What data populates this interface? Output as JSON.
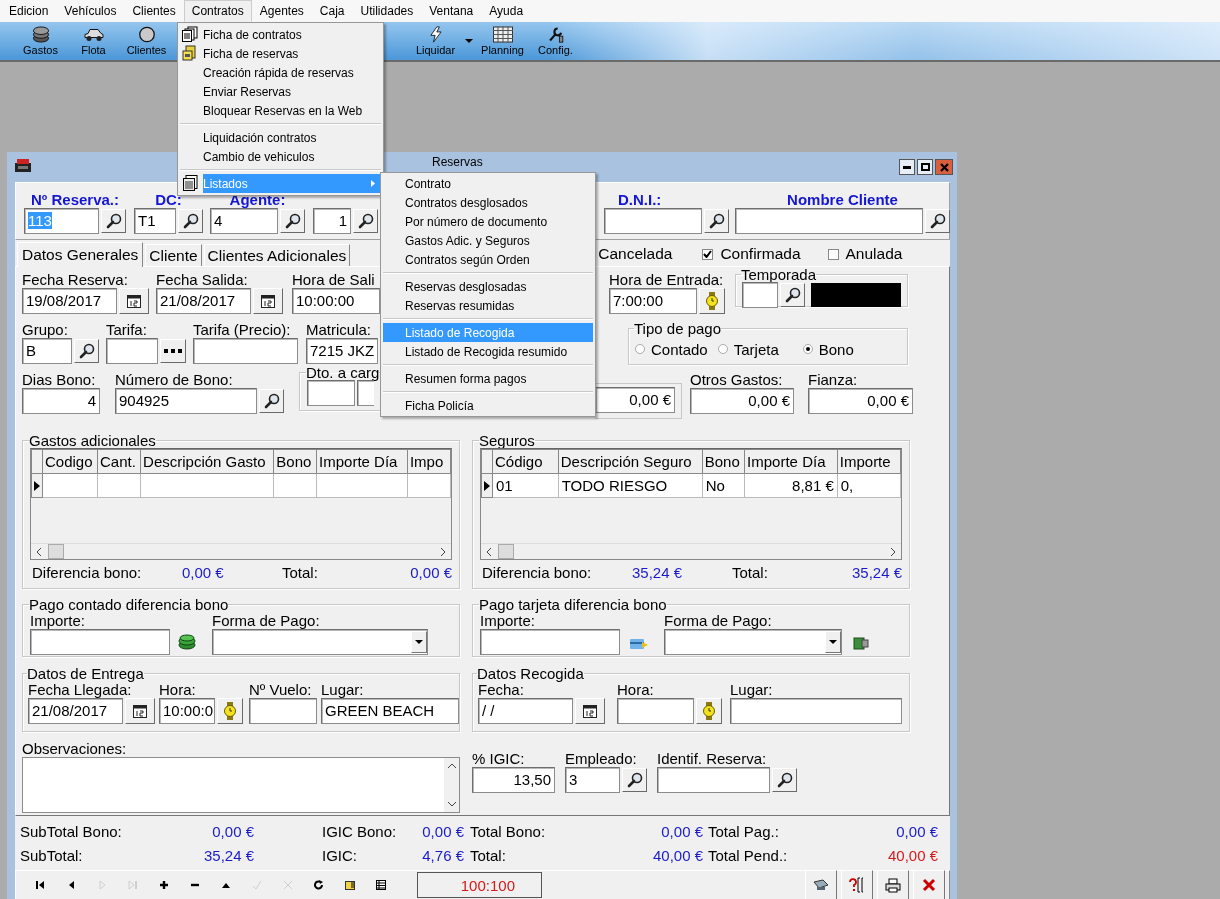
{
  "menu_bar": {
    "items": [
      {
        "label": "Edicion",
        "selected": false
      },
      {
        "label": "Vehículos",
        "selected": false
      },
      {
        "label": "Clientes",
        "selected": false
      },
      {
        "label": "Contratos",
        "selected": true
      },
      {
        "label": "Agentes",
        "selected": false
      },
      {
        "label": "Caja",
        "selected": false
      },
      {
        "label": "Utilidades",
        "selected": false
      },
      {
        "label": "Ventana",
        "selected": false
      },
      {
        "label": "Ayuda",
        "selected": false
      }
    ]
  },
  "toolbar": {
    "buttons": [
      {
        "kind": "money",
        "label": "Gastos"
      },
      {
        "kind": "car",
        "label": "Flota"
      },
      {
        "kind": "circle",
        "label": "Clientes"
      },
      {
        "kind": "bolt",
        "label": "Liquidar"
      },
      {
        "kind": "dropdown"
      },
      {
        "kind": "grid",
        "label": "Planning"
      },
      {
        "kind": "tool",
        "label": "Config."
      }
    ]
  },
  "contratos_menu": {
    "items": [
      {
        "kind": "item",
        "label": "Ficha de contratos",
        "selected": false
      },
      {
        "kind": "item",
        "label": "Ficha de reservas",
        "selected": false
      },
      {
        "kind": "item",
        "label": "Creación rápida de reservas",
        "selected": false
      },
      {
        "kind": "item",
        "label": "Enviar Reservas",
        "selected": false
      },
      {
        "kind": "item",
        "label": "Bloquear Reservas en la Web",
        "selected": false
      },
      {
        "kind": "separator"
      },
      {
        "kind": "item",
        "label": "Liquidación contratos",
        "selected": false
      },
      {
        "kind": "item",
        "label": "Cambio de vehiculos",
        "selected": false
      },
      {
        "kind": "separator"
      },
      {
        "kind": "submenu",
        "label": "Listados",
        "selected": true
      }
    ]
  },
  "listados_menu": {
    "items": [
      {
        "kind": "item",
        "label": "Contrato",
        "selected": false
      },
      {
        "kind": "item",
        "label": "Contratos desglosados",
        "selected": false
      },
      {
        "kind": "item",
        "label": "Por número de documento",
        "selected": false
      },
      {
        "kind": "item",
        "label": "Gastos Adic. y Seguros",
        "selected": false
      },
      {
        "kind": "item",
        "label": "Contratos según Orden",
        "selected": false
      },
      {
        "kind": "separator"
      },
      {
        "kind": "item",
        "label": "Reservas desglosadas",
        "selected": false
      },
      {
        "kind": "item",
        "label": "Reservas resumidas",
        "selected": false
      },
      {
        "kind": "separator"
      },
      {
        "kind": "item",
        "label": "Listado de Recogida",
        "selected": true
      },
      {
        "kind": "item",
        "label": "Listado de Recogida resumido",
        "selected": false
      },
      {
        "kind": "separator"
      },
      {
        "kind": "item",
        "label": "Resumen forma pagos",
        "selected": false
      },
      {
        "kind": "separator"
      },
      {
        "kind": "item",
        "label": "Ficha Policía",
        "selected": false
      }
    ]
  },
  "window": {
    "title": "Reservas"
  },
  "header": {
    "fields": [
      {
        "label": "Nº Reserva.:",
        "value": "113",
        "highlighted": true
      },
      {
        "label": "DC:",
        "value": "T1",
        "highlighted": false
      },
      {
        "label": "Agente:",
        "value": "4",
        "highlighted": false
      },
      {
        "value": "1",
        "highlighted": false
      },
      {
        "label": "D.N.I.:"
      },
      {
        "label": "Nombre Cliente"
      }
    ]
  },
  "tabs": [
    {
      "label": "Datos Generales",
      "selected": true
    },
    {
      "label": "Cliente",
      "selected": false
    },
    {
      "label": "Clientes Adicionales",
      "selected": false
    }
  ],
  "status_options": [
    {
      "label": "Cancelada"
    },
    {
      "label": "Confirmada",
      "checked": true
    },
    {
      "label": "Anulada",
      "checked": false
    }
  ],
  "general": {
    "fecha_reserva": {
      "label": "Fecha Reserva:",
      "value": "19/08/2017"
    },
    "fecha_salida": {
      "label": "Fecha Salida:",
      "value": "21/08/2017"
    },
    "hora_salida": {
      "label": "Hora de Sali",
      "value": "10:00:00"
    },
    "hora_entrada": {
      "label": "Hora de Entrada:",
      "value": "7:00:00"
    },
    "temporada": {
      "title": "Temporada"
    },
    "grupo": {
      "label": "Grupo:",
      "value": "B"
    },
    "tarifa": {
      "label": "Tarifa:"
    },
    "tarifa_precio": {
      "label": "Tarifa (Precio):"
    },
    "matricula": {
      "label": "Matricula:",
      "value": "7215 JKZ"
    },
    "tipo_pago": {
      "title": "Tipo de pago",
      "options": [
        {
          "label": "Contado",
          "selected": false
        },
        {
          "label": "Tarjeta",
          "selected": false
        },
        {
          "label": "Bono",
          "selected": true
        }
      ]
    },
    "dias_bono": {
      "label": "Dias Bono:",
      "value": "4"
    },
    "numero_bono": {
      "label": "Número de Bono:",
      "value": "904925"
    },
    "dto": {
      "title": "Dto. a carg"
    },
    "importe": {
      "value": "0,00 €"
    },
    "otros_gastos": {
      "label": "Otros Gastos:",
      "value": "0,00 €"
    },
    "fianza": {
      "label": "Fianza:",
      "value": "0,00 €"
    }
  },
  "gastos": {
    "title": "Gastos adicionales",
    "columns": [
      "Codigo",
      "Cant.",
      "Descripción Gasto",
      "Bono",
      "Importe Día",
      "Impo"
    ],
    "rows": [
      {
        "selected": true,
        "cells": []
      }
    ],
    "totals": {
      "diff_label": "Diferencia bono:",
      "diff_value": "0,00 €",
      "total_label": "Total:",
      "total_value": "0,00 €"
    }
  },
  "seguros": {
    "title": "Seguros",
    "columns": [
      "Código",
      "Descripción Seguro",
      "Bono",
      "Importe Día",
      "Importe"
    ],
    "rows": [
      {
        "selected": true,
        "cells": [
          "01",
          "TODO RIESGO",
          "No",
          "8,81 €",
          "0,"
        ]
      }
    ],
    "totals": {
      "diff_label": "Diferencia bono:",
      "diff_value": "35,24 €",
      "total_label": "Total:",
      "total_value": "35,24 €"
    }
  },
  "pago_contado": {
    "title": "Pago contado diferencia bono",
    "importe_label": "Importe:",
    "forma_label": "Forma de Pago:"
  },
  "pago_tarjeta": {
    "title": "Pago tarjeta diferencia bono",
    "importe_label": "Importe:",
    "forma_label": "Forma de Pago:"
  },
  "entrega": {
    "title": "Datos de Entrega",
    "fields": [
      {
        "label": "Fecha Llegada:",
        "value": "21/08/2017"
      },
      {
        "label": "Hora:",
        "value": "10:00:0"
      },
      {
        "label": "Nº Vuelo:"
      },
      {
        "label": "Lugar:",
        "value": "GREEN BEACH"
      }
    ]
  },
  "recogida": {
    "title": "Datos Recogida",
    "fields": [
      {
        "label": "Fecha:",
        "value": "/ /"
      },
      {
        "label": "Hora:"
      },
      {
        "label": "Lugar:"
      }
    ]
  },
  "observaciones": {
    "label": "Observaciones:"
  },
  "igic": {
    "label": "% IGIC:",
    "value": "13,50"
  },
  "empleado": {
    "label": "Empleado:",
    "value": "3"
  },
  "identif": {
    "label": "Identif. Reserva:"
  },
  "summary": [
    [
      {
        "label": "SubTotal Bono:",
        "value": "0,00 €",
        "alert": false
      },
      {
        "label": "IGIC Bono:",
        "value": "0,00 €",
        "alert": false
      },
      {
        "label": "Total Bono:",
        "value": "0,00 €",
        "alert": false
      },
      {
        "label": "Total Pag.:",
        "value": "0,00 €",
        "alert": false
      }
    ],
    [
      {
        "label": "SubTotal:",
        "value": "35,24 €",
        "alert": false
      },
      {
        "label": "IGIC:",
        "value": "4,76 €",
        "alert": false
      },
      {
        "label": "Total:",
        "value": "40,00 €",
        "alert": false
      },
      {
        "label": "Total Pend.:",
        "value": "40,00 €",
        "alert": true
      }
    ]
  ],
  "navigator": {
    "buttons": [
      {
        "kind": "first",
        "disabled": false
      },
      {
        "kind": "prev",
        "disabled": false
      },
      {
        "kind": "next",
        "disabled": true
      },
      {
        "kind": "last",
        "disabled": true
      },
      {
        "kind": "plus",
        "disabled": false
      },
      {
        "kind": "minus",
        "disabled": false
      },
      {
        "kind": "up",
        "disabled": false
      },
      {
        "kind": "check",
        "disabled": true
      },
      {
        "kind": "cancel",
        "disabled": true
      },
      {
        "kind": "refresh",
        "disabled": false
      },
      {
        "kind": "hand",
        "disabled": false
      },
      {
        "kind": "table",
        "disabled": false
      }
    ],
    "counter": "100:100",
    "actions": [
      {
        "kind": "preview"
      },
      {
        "kind": "help"
      },
      {
        "kind": "print"
      },
      {
        "kind": "close"
      }
    ]
  }
}
